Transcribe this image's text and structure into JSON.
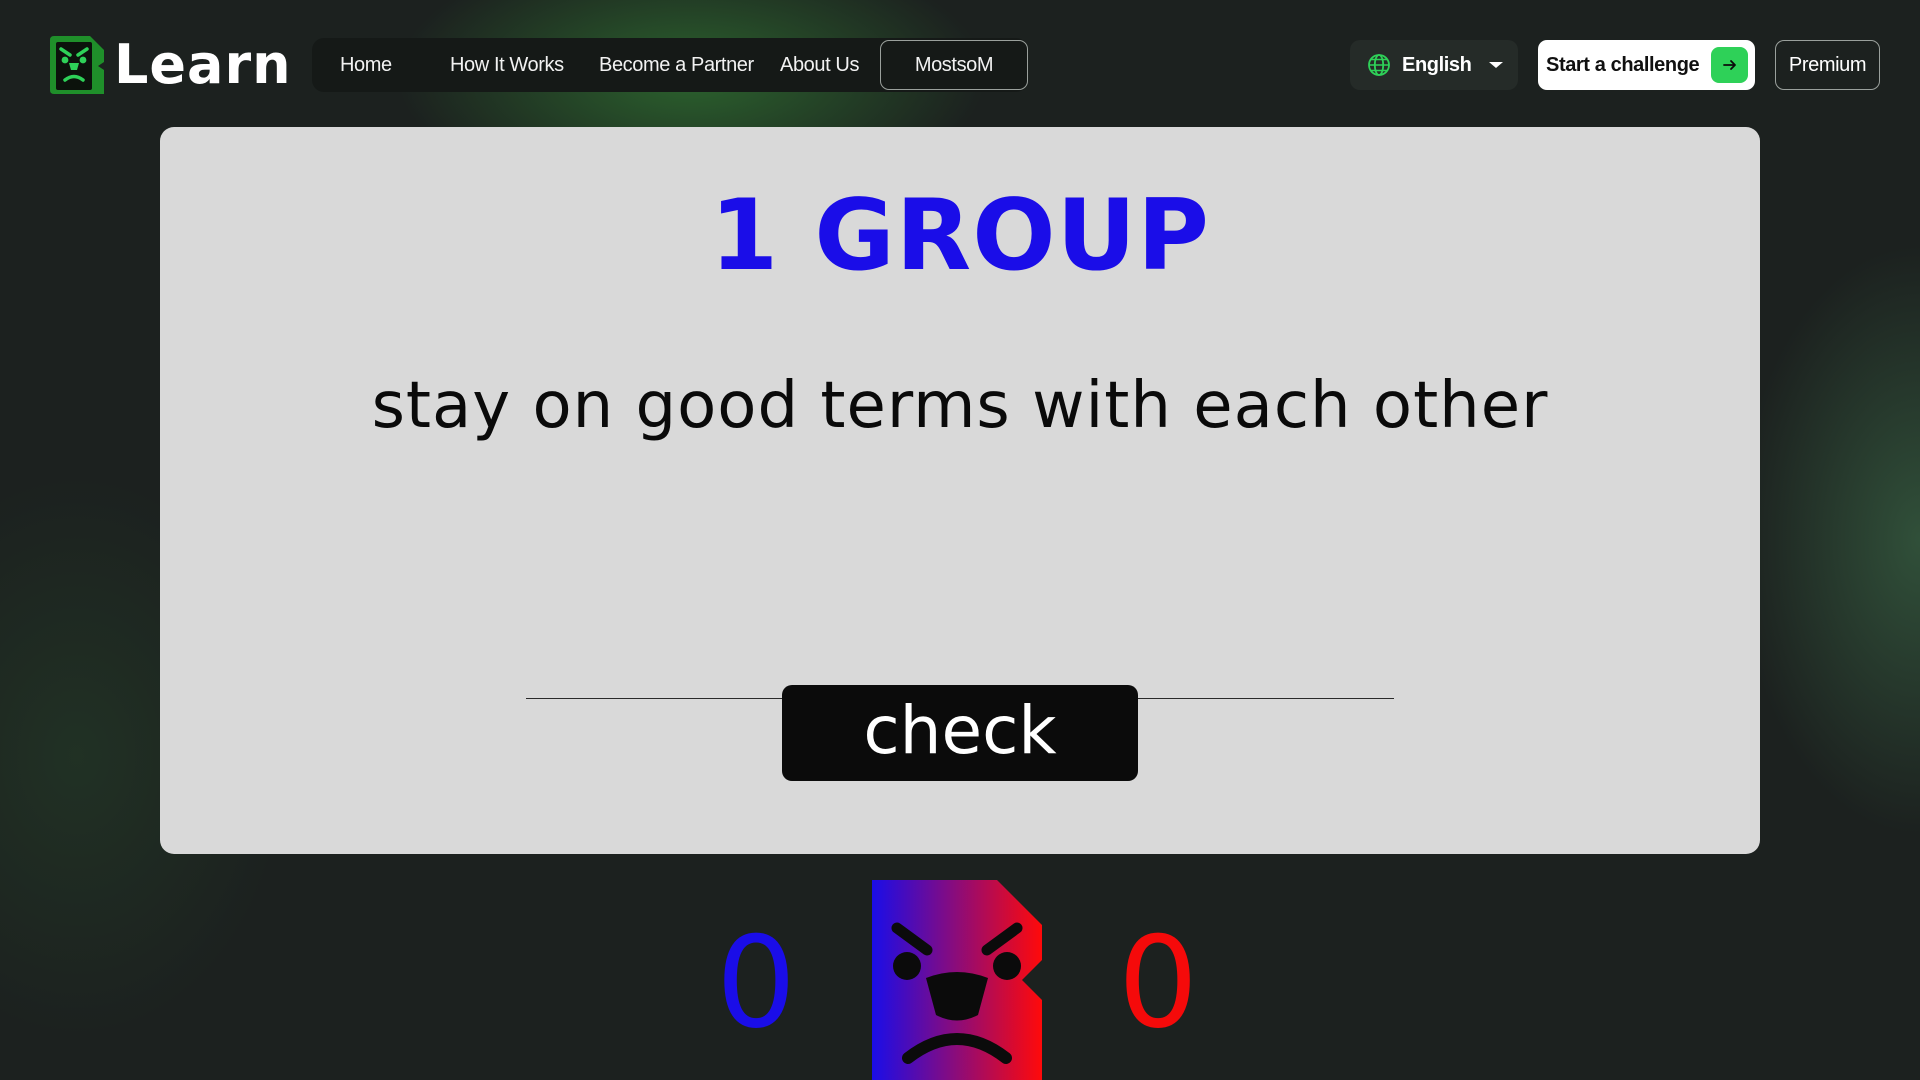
{
  "header": {
    "logo_text": "Learn",
    "nav": {
      "home": "Home",
      "how_it_works": "How It Works",
      "become_partner": "Become a Partner",
      "about_us": "About Us",
      "user": "MostsoM"
    },
    "language": "English",
    "cta_label": "Start a challenge",
    "premium_label": "Premium"
  },
  "card": {
    "group_title": "1 GROUP",
    "phrase": "stay on good terms with each other",
    "answer_value": "",
    "check_label": "check"
  },
  "score": {
    "blue": "0",
    "red": "0"
  },
  "colors": {
    "blue": "#1a0de8",
    "red": "#f50a0a",
    "accent_green": "#2ed158",
    "card_bg": "#d9d9d9",
    "page_bg": "#1c211f"
  },
  "icons": {
    "logo": "angry-face-logo-icon",
    "language": "globe-icon",
    "dropdown": "chevron-down-icon",
    "cta": "arrow-right-icon",
    "mascot": "angry-face-mascot-icon"
  }
}
